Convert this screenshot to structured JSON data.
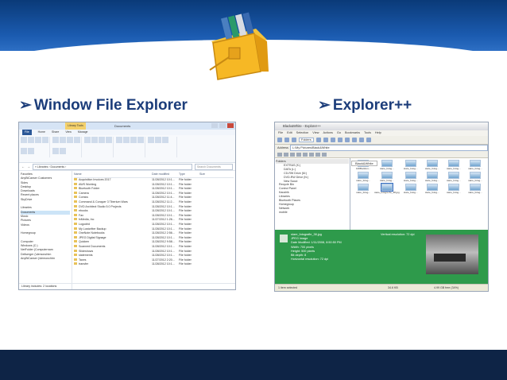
{
  "headings": {
    "left": "Window File Explorer",
    "right": "Explorer++"
  },
  "win_explorer": {
    "title": "Documents",
    "context_tab": "Library Tools",
    "tabs": [
      "File",
      "Home",
      "Share",
      "View",
      "Manage"
    ],
    "address": "« Libraries › Documents ›",
    "search_placeholder": "Search Documents",
    "columns": [
      "Name",
      "Date modified",
      "Type",
      "Size"
    ],
    "nav": [
      "Favorites",
      "AnyBiCanser Customers",
      "Sides",
      "Desktop",
      "Downloads",
      "Recent places",
      "SkyDrive",
      "",
      "Libraries",
      "Documents",
      "Music",
      "Pictures",
      "Videos",
      "",
      "Homegroup",
      "",
      "Computer",
      "Windows (C:)",
      "NetFolder (Computernam",
      "Dellserger (\\demonchtm",
      "AnyBiCanser (\\demonchtm"
    ],
    "rows": [
      {
        "name": "Acquisition Invoices 2017",
        "date": "11/28/2012 10:1...",
        "type": "File folder"
      },
      {
        "name": "AWS Working",
        "date": "11/28/2012 10:1...",
        "type": "File folder"
      },
      {
        "name": "Bluetooth Folder",
        "date": "11/28/2012 10:1...",
        "type": "File folder"
      },
      {
        "name": "Camera",
        "date": "11/28/2012 10:1...",
        "type": "File folder"
      },
      {
        "name": "Comics",
        "date": "11/28/2012 11:4...",
        "type": "File folder"
      },
      {
        "name": "Command & Conquer 3 Tiberium Wars",
        "date": "11/28/2012 11:2...",
        "type": "File folder"
      },
      {
        "name": "DVD Architect Studio 5.0 Projects",
        "date": "11/28/2012 10:1...",
        "type": "File folder"
      },
      {
        "name": "ebooks",
        "date": "11/28/2012 10:1...",
        "type": "File folder"
      },
      {
        "name": "Fax",
        "date": "11/28/2012 10:1...",
        "type": "File folder"
      },
      {
        "name": "fxMedia, Inc",
        "date": "11/27/2012 1:26...",
        "type": "File folder"
      },
      {
        "name": "Logodrid",
        "date": "11/28/2012 10:1...",
        "type": "File folder"
      },
      {
        "name": "My Lostcritter Backup",
        "date": "11/28/2012 10:1...",
        "type": "File folder"
      },
      {
        "name": "OneNote Notebooks",
        "date": "11/28/2012 2:56...",
        "type": "File folder"
      },
      {
        "name": "JPEG Digital Signage",
        "date": "11/28/2012 10:1...",
        "type": "File folder"
      },
      {
        "name": "Quicken",
        "date": "11/28/2012 9:58...",
        "type": "File folder"
      },
      {
        "name": "Scanned Documents",
        "date": "11/28/2012 10:1...",
        "type": "File folder"
      },
      {
        "name": "Slideshows",
        "date": "11/28/2012 10:1...",
        "type": "File folder"
      },
      {
        "name": "statements",
        "date": "11/28/2012 10:1...",
        "type": "File folder"
      },
      {
        "name": "Taxes",
        "date": "11/27/2012 2:20...",
        "type": "File folder"
      },
      {
        "name": "transfer",
        "date": "11/28/2012 10:1...",
        "type": "File folder"
      }
    ],
    "status": "Library includes: 2 locations"
  },
  "explorerpp": {
    "title": "Black&White - Explorer++",
    "menu": [
      "File",
      "Edit",
      "Selection",
      "View",
      "Actions",
      "Go",
      "Bookmarks",
      "Tools",
      "Help"
    ],
    "address_label": "Address",
    "address": "L:\\My Pictures\\Black&White",
    "folders_button": "Folders",
    "tree_header": "Folders",
    "tree": [
      "EXTRAS (K:)",
      "DATA (L:)",
      "CD-RW Drive (M:)",
      "DVD-RW Drive (N:)",
      "New Scout",
      "Recycle Bin",
      "Control Panel",
      "Kaushik",
      "Libraries",
      "Bluetooth Places",
      "Homegroup",
      "Network",
      "mobile"
    ],
    "tab": "Black&White",
    "thumbs": [
      "100Bucklon...",
      "stare_fotog...",
      "stare_fotog...",
      "stare_fotog...",
      "stare_fotog...",
      "stare_fotog...",
      "stare_fotog...",
      "stare_fotog...",
      "stare_fotog...",
      "stare_fotog...",
      "stare_fotog...",
      "stare_fotog...",
      "stare_fotog...",
      "stare_fotogra fie_38.jpg",
      "stare_fotog...",
      "stare_fotog...",
      "stare_fotog...",
      "stare_fotog..."
    ],
    "preview": {
      "name": "stare_fotografie_38.jpg",
      "kind": "JPEG image",
      "modified": "Date Modified: 1/11/2008, 8:50:50 PM",
      "width": "Width: 700 pixels",
      "height": "Height: 500 pixels",
      "depth": "Bit depth: 8",
      "hres": "Horizontal resolution: 72 dpi",
      "vres": "Vertical resolution: 72 dpi"
    },
    "status": [
      "1 item selected",
      "34.6 KB",
      "4.99 GB free (34%)"
    ]
  }
}
